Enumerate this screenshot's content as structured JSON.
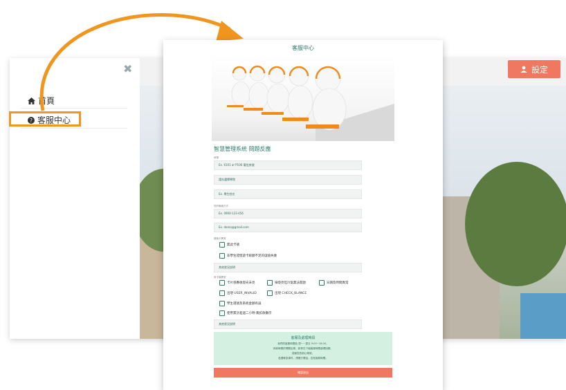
{
  "sidebar": {
    "close_icon": "✖",
    "items": [
      {
        "label": "首頁",
        "icon": "home-icon"
      },
      {
        "label": "客服中心",
        "icon": "question-circle-icon"
      }
    ]
  },
  "header": {
    "settings_label": "設定",
    "settings_icon": "user-icon"
  },
  "form": {
    "card_title": "客服中心",
    "heading": "智慧管理系統 問題反應",
    "label_room": "房號",
    "placeholder_room": "Ex. 6101 or P106 電信房號",
    "placeholder_college": "請先選擇學院",
    "placeholder_student": "Ex. 學生姓名",
    "label_contact": "您的聯絡方式",
    "placeholder_phone": "Ex. 0900-123-456",
    "placeholder_email": "Ex. demo@gmail.com",
    "label_section1": "儲值卡異常",
    "section1_options": [
      "無此卡號",
      "非學生證悠遊卡餘額不足的儲值失敗"
    ],
    "other1": "其他狀況說明",
    "label_section2": "房卡機異常",
    "section2_options": [
      "卡片感應後燈光未亮",
      "綠燈亮但冷氣無法開啟",
      "日期及時間異常",
      "出現 USER_INVALID",
      "出現 CHECK_BLANCE",
      "學生證號及系統金額有誤",
      "使用累計超過二小時-無扣款顯示"
    ],
    "other2": "其他狀況說明",
    "notice_title": "客服及處理時段",
    "notice_lines": [
      "我們的客服時間為 週一~週五 9:00~18:00。",
      "其餘時間的問題反應，將會在下個客服時間處理回覆。",
      "感謝您的耐心等候，",
      "若遇緊急事件，請撥打電話，告知客服時間。"
    ],
    "submit_label": "確認送出"
  },
  "colors": {
    "accent": "#f07860",
    "highlight": "#f0961e",
    "teal": "#2a7a6a",
    "notice_bg": "#d4f0e0"
  }
}
